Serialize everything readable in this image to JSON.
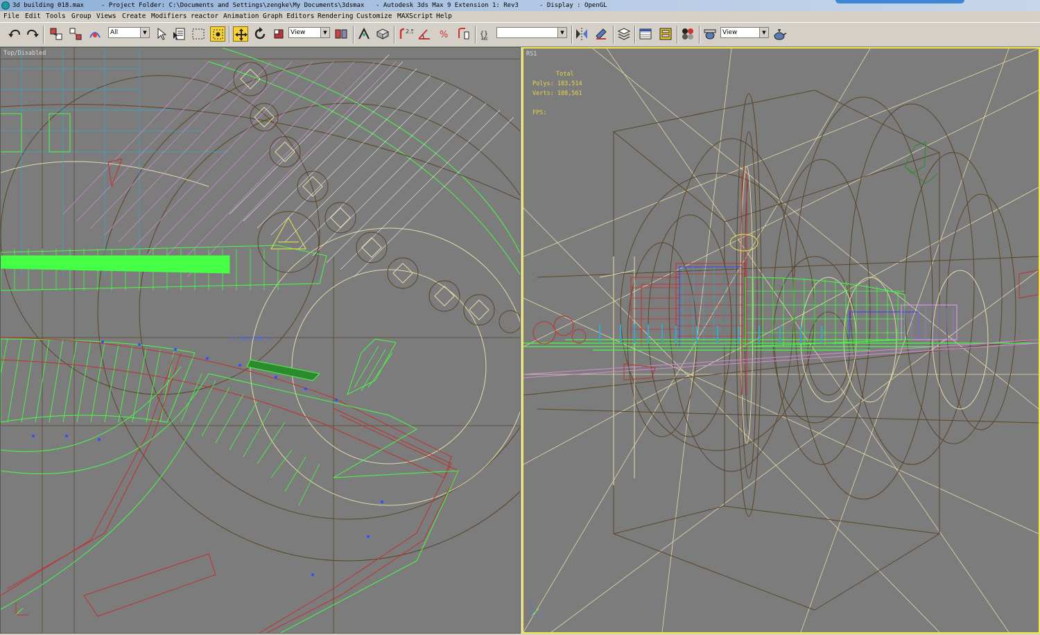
{
  "window": {
    "file_title": "3d building 018.max",
    "project_folder": "- Project Folder: C:\\Documents and Settings\\zengke\\My Documents\\3dsmax",
    "app_title": "- Autodesk 3ds Max 9 Extension 1: Rev3",
    "display": "- Display : OpenGL"
  },
  "menu": [
    "File",
    "Edit",
    "Tools",
    "Group",
    "Views",
    "Create",
    "Modifiers",
    "reactor",
    "Animation",
    "Graph Editors",
    "Rendering",
    "Customize",
    "MAXScript",
    "Help"
  ],
  "toolbar": {
    "selection_filter": "All",
    "reference_coord": "View",
    "named_selection": "",
    "render_preset": "View",
    "icons": [
      "undo-icon",
      "redo-icon",
      "select-link-icon",
      "unlink-icon",
      "bind-space-warp-icon",
      "select-object-icon",
      "select-by-name-icon",
      "rectangular-region-icon",
      "window-crossing-icon",
      "select-move-icon",
      "select-rotate-icon",
      "select-scale-icon",
      "pivot-center-icon",
      "manipulate-icon",
      "snap-toggle-icon",
      "angle-snap-icon",
      "percent-snap-icon",
      "spinner-snap-icon",
      "edit-named-selection-icon",
      "mirror-icon",
      "align-icon",
      "layer-manager-icon",
      "curve-editor-icon",
      "schematic-view-icon",
      "material-editor-icon",
      "render-scene-icon",
      "quick-render-icon"
    ]
  },
  "viewports": {
    "left": {
      "label": "Top/Disabled",
      "overlay": "<< SECTION <<"
    },
    "right": {
      "label": "RS1",
      "stats": {
        "header": "Total",
        "polys": "Polys: 183,514",
        "verts": "Verts: 108,561",
        "fps": "FPS:"
      }
    }
  },
  "colors": {
    "active_border": "#f3e84a",
    "viewport_bg": "#7c7c7c",
    "wire_green": "#44ff44",
    "wire_brown": "#5a4426",
    "wire_cream": "#e8dca8",
    "wire_cyan": "#3aa6c8",
    "wire_red": "#c03030",
    "wire_pink": "#d88ad8"
  }
}
